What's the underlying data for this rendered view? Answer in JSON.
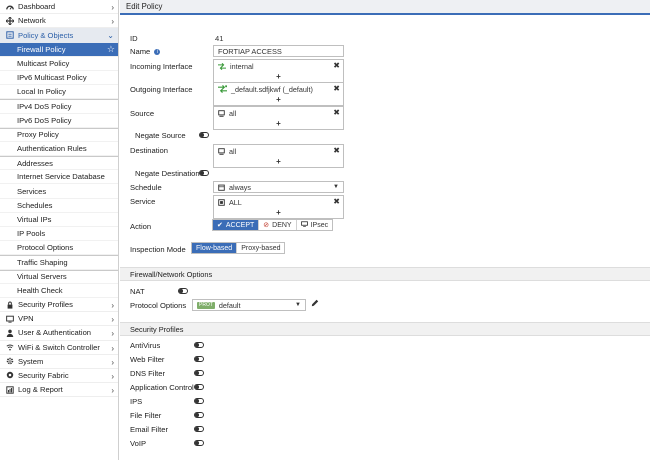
{
  "sidebar": {
    "top_items_a": [
      {
        "label": "Dashboard",
        "icon": "dashboard-icon"
      },
      {
        "label": "Network",
        "icon": "network-icon"
      }
    ],
    "open_section": {
      "label": "Policy & Objects",
      "icon": "policy-icon"
    },
    "sub_items": [
      {
        "label": "Firewall Policy",
        "active": true
      },
      {
        "label": "Multicast Policy"
      },
      {
        "label": "IPv6 Multicast Policy"
      },
      {
        "label": "Local In Policy"
      },
      {
        "label": "IPv4 DoS Policy"
      },
      {
        "label": "IPv6 DoS Policy"
      },
      {
        "label": "Proxy Policy"
      },
      {
        "label": "Authentication Rules"
      },
      {
        "label": "Addresses"
      },
      {
        "label": "Internet Service Database"
      },
      {
        "label": "Services"
      },
      {
        "label": "Schedules"
      },
      {
        "label": "Virtual IPs"
      },
      {
        "label": "IP Pools"
      },
      {
        "label": "Protocol Options"
      },
      {
        "label": "Traffic Shaping"
      },
      {
        "label": "Virtual Servers"
      },
      {
        "label": "Health Check"
      }
    ],
    "top_items_b": [
      {
        "label": "Security Profiles",
        "icon": "lock-icon"
      },
      {
        "label": "VPN",
        "icon": "vpn-icon"
      },
      {
        "label": "User & Authentication",
        "icon": "user-icon"
      },
      {
        "label": "WiFi & Switch Controller",
        "icon": "wifi-icon"
      },
      {
        "label": "System",
        "icon": "gear-icon"
      },
      {
        "label": "Security Fabric",
        "icon": "fabric-icon"
      },
      {
        "label": "Log & Report",
        "icon": "log-icon"
      }
    ]
  },
  "header": {
    "title": "Edit Policy"
  },
  "form": {
    "id_label": "ID",
    "id_value": "41",
    "name_label": "Name",
    "name_value": "FORTIAP ACCESS",
    "incoming_label": "Incoming Interface",
    "incoming_value": "internal",
    "outgoing_label": "Outgoing Interface",
    "outgoing_value": "_default.sdfjkwf (_default)",
    "source_label": "Source",
    "source_value": "all",
    "negate_source_label": "Negate Source",
    "destination_label": "Destination",
    "destination_value": "all",
    "negate_destination_label": "Negate Destination",
    "schedule_label": "Schedule",
    "schedule_value": "always",
    "service_label": "Service",
    "service_value": "ALL",
    "action_label": "Action",
    "action_options": [
      "ACCEPT",
      "DENY",
      "IPsec"
    ],
    "inspection_label": "Inspection Mode",
    "inspection_options": [
      "Flow-based",
      "Proxy-based"
    ],
    "plus": "+",
    "remove": "✖"
  },
  "firewall_section": {
    "title": "Firewall/Network Options",
    "nat_label": "NAT",
    "protocol_label": "Protocol Options",
    "protocol_badge": "PROT",
    "protocol_value": "default"
  },
  "security_section": {
    "title": "Security Profiles",
    "profiles": [
      "AntiVirus",
      "Web Filter",
      "DNS Filter",
      "Application Control",
      "IPS",
      "File Filter",
      "Email Filter",
      "VoIP"
    ]
  },
  "colors": {
    "accent": "#3b6db7",
    "badge": "#7fae6a"
  }
}
